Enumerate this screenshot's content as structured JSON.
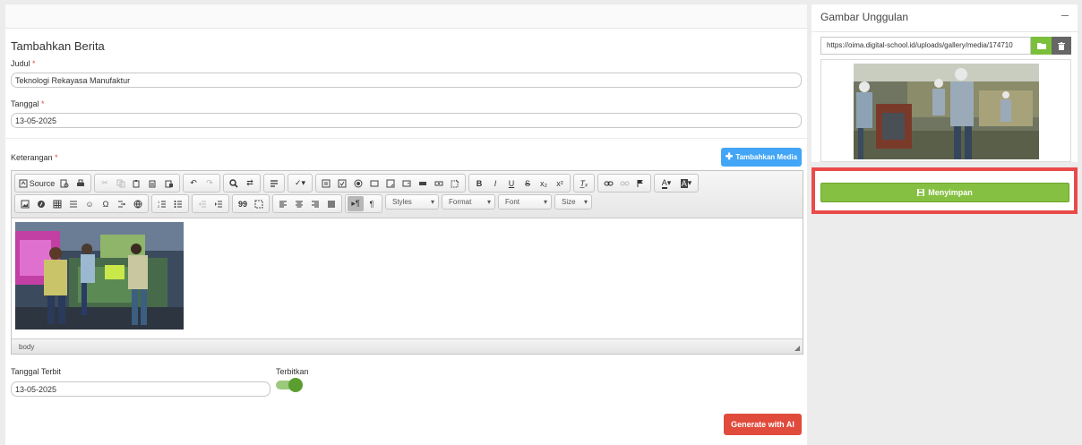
{
  "form": {
    "title": "Tambahkan Berita",
    "judul_label": "Judul",
    "judul_value": "Teknologi Rekayasa Manufaktur",
    "tanggal_label": "Tanggal",
    "tanggal_value": "13-05-2025",
    "keterangan_label": "Keterangan",
    "required_mark": "*",
    "tambah_media_label": "Tambahkan Media",
    "tanggal_terbit_label": "Tanggal Terbit",
    "tanggal_terbit_value": "13-05-2025",
    "terbitkan_label": "Terbitkan",
    "terbitkan_on": true,
    "generate_ai_label": "Generate with AI"
  },
  "editor": {
    "source_label": "Source",
    "combos": {
      "styles": "Styles",
      "format": "Format",
      "font": "Font",
      "size": "Size"
    },
    "text_buttons": {
      "bold": "B",
      "italic": "I",
      "underline": "U",
      "strike": "S",
      "blockquote": "99",
      "special_char": "Ω",
      "paragraph_mark": "¶"
    },
    "statusbar_path": "body",
    "image_alt": "students inspecting machinery in workshop"
  },
  "sidebar": {
    "title": "Gambar Unggulan",
    "image_url": "https://oima.digital-school.id/uploads/gallery/media/174710",
    "image_alt": "workers assembling engine on production line",
    "save_label": "Menyimpan"
  },
  "colors": {
    "primary_blue": "#42a5f5",
    "success_green": "#86c042",
    "danger_red": "#e14b3b",
    "highlight_red": "#e94a4a",
    "toggle_green": "#5a9e2f"
  }
}
